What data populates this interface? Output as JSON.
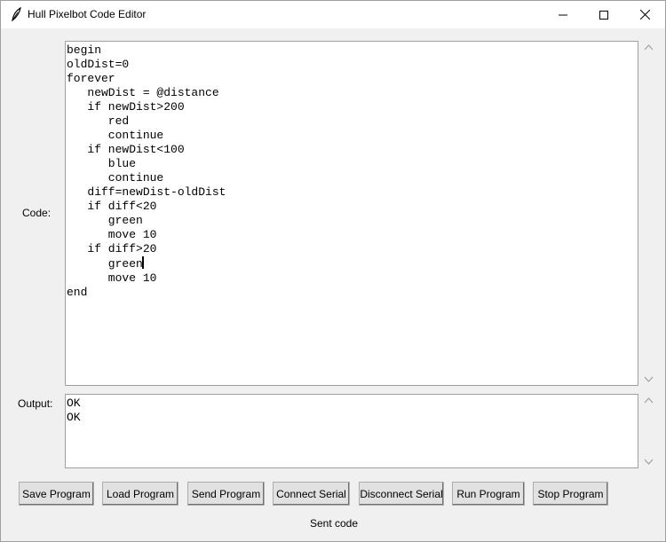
{
  "window": {
    "title": "Hull Pixelbot Code Editor",
    "icon": "feather-icon",
    "controls": [
      "minimize-icon",
      "maximize-icon",
      "close-icon"
    ]
  },
  "code_label": "Code:",
  "output_label": "Output:",
  "code": {
    "lines": [
      "begin",
      "oldDist=0",
      "forever",
      "   newDist = @distance",
      "   if newDist>200",
      "      red",
      "      continue",
      "   if newDist<100",
      "      blue",
      "      continue",
      "   diff=newDist-oldDist",
      "   if diff<20",
      "      green",
      "      move 10",
      "   if diff>20",
      "      green",
      "      move 10",
      "end"
    ]
  },
  "output": {
    "lines": [
      "OK",
      "OK"
    ]
  },
  "buttons": {
    "save": "Save Program",
    "load": "Load Program",
    "send": "Send Program",
    "connect": "Connect Serial",
    "disconnect": "Disconnect Serial",
    "run": "Run Program",
    "stop": "Stop Program"
  },
  "status": "Sent code"
}
